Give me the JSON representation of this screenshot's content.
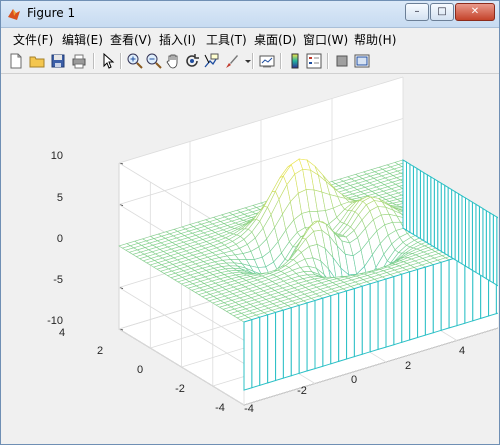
{
  "window": {
    "title": "Figure 1",
    "controls": {
      "minimize": "–",
      "maximize": "□",
      "close": "✕"
    }
  },
  "menu": [
    "文件(F)",
    "编辑(E)",
    "查看(V)",
    "插入(I)",
    "工具(T)",
    "桌面(D)",
    "窗口(W)",
    "帮助(H)"
  ],
  "toolbar": {
    "icons": [
      "new-figure-icon",
      "open-file-icon",
      "save-icon",
      "print-icon",
      "select-arrow-icon",
      "zoom-in-icon",
      "zoom-out-icon",
      "pan-icon",
      "rotate-3d-icon",
      "data-cursor-icon",
      "brush-icon",
      "link-plot-icon",
      "colorbar-icon",
      "legend-icon",
      "hide-plot-tools-icon",
      "show-plot-tools-icon"
    ]
  },
  "chart_data": {
    "type": "surface-mesh (peaks)",
    "zlim": [
      -10,
      10
    ],
    "xlim": [
      -4,
      4
    ],
    "ylim": [
      -4,
      4
    ],
    "z_ticks": [
      "10",
      "5",
      "0",
      "-5",
      "-10"
    ],
    "x_ticks": [
      "-4",
      "-2",
      "0",
      "2",
      "4"
    ],
    "y_ticks": [
      "4",
      "2",
      "0",
      "-2",
      "-4"
    ],
    "colormap_colors": {
      "low": "#2bbfc4",
      "high": "#f5e64a"
    },
    "grid": true,
    "view": "3d-default"
  }
}
